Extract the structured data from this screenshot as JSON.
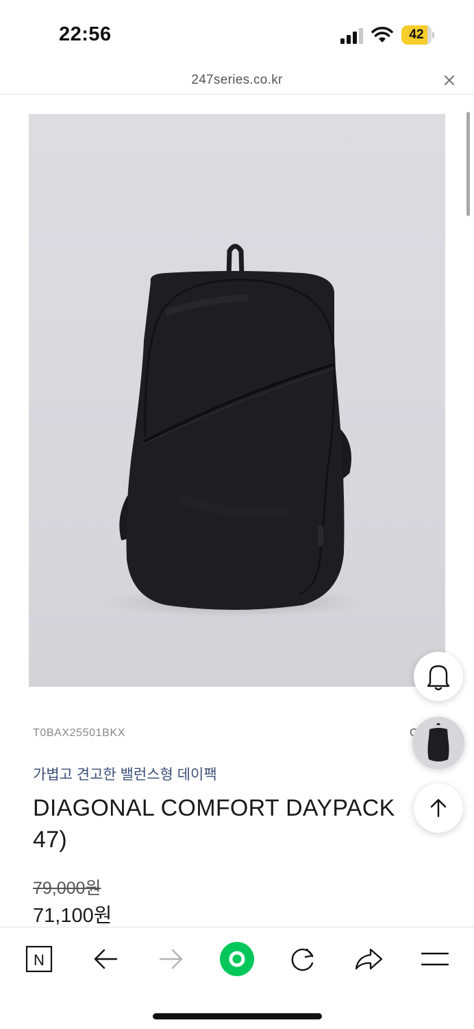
{
  "status_bar": {
    "time": "22:56",
    "battery_level": "42",
    "icons": [
      "signal-icon",
      "wifi-icon",
      "battery-icon"
    ]
  },
  "browser": {
    "url": "247series.co.kr",
    "close_icon": "close-icon"
  },
  "product": {
    "image_icon": "backpack-image",
    "sku": "T0BAX25501BKX",
    "subtitle": "가볍고 견고한 밸런스형 데이팩",
    "title": "DIAGONAL COMFORT DAYPACK 47)",
    "price_original": "79,000원",
    "price_sale": "71,100원",
    "stray_text": "C"
  },
  "floating_buttons": {
    "notify": "bell-icon",
    "recent": "product-thumbnail",
    "scroll_top": "arrow-up-icon"
  },
  "toolbar": {
    "items": [
      {
        "name": "naver-home",
        "glyph": "N"
      },
      {
        "name": "back",
        "icon": "arrow-left-icon"
      },
      {
        "name": "forward",
        "icon": "arrow-right-icon"
      },
      {
        "name": "green-dot",
        "icon": "green-circle-icon"
      },
      {
        "name": "reload",
        "icon": "reload-icon"
      },
      {
        "name": "share",
        "icon": "share-icon"
      },
      {
        "name": "menu",
        "icon": "hamburger-icon"
      }
    ],
    "accent": "#03c75a"
  }
}
